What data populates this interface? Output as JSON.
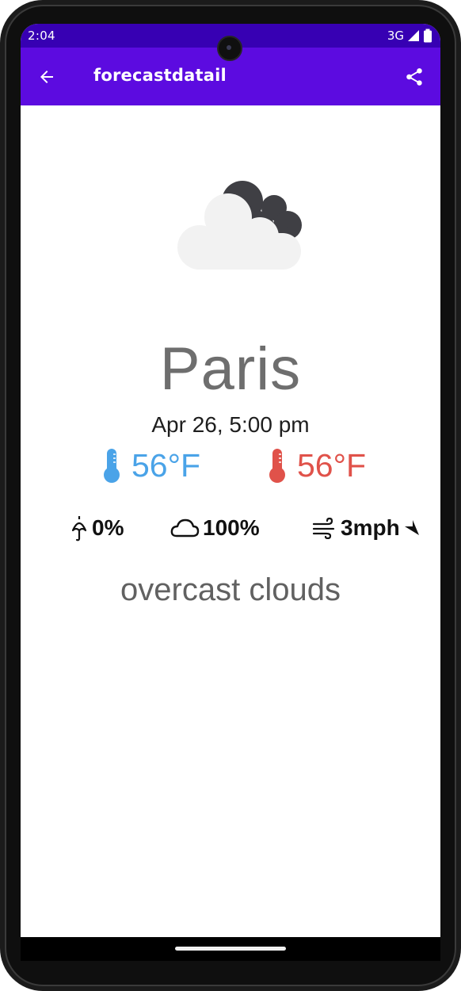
{
  "status_bar": {
    "time": "2:04",
    "network": "3G"
  },
  "app_bar": {
    "title": "forecastdatail",
    "back_icon": "arrow-back-icon",
    "share_icon": "share-icon",
    "color": "#5c0be0"
  },
  "forecast": {
    "icon": "overcast-clouds-icon",
    "city": "Paris",
    "datetime": "Apr 26, 5:00 pm",
    "temp_min": "56°F",
    "temp_max": "56°F",
    "temp_min_color": "#4aa3e8",
    "temp_max_color": "#e0524a",
    "precipitation": "0%",
    "cloudiness": "100%",
    "wind": "3mph",
    "description": "overcast clouds"
  }
}
